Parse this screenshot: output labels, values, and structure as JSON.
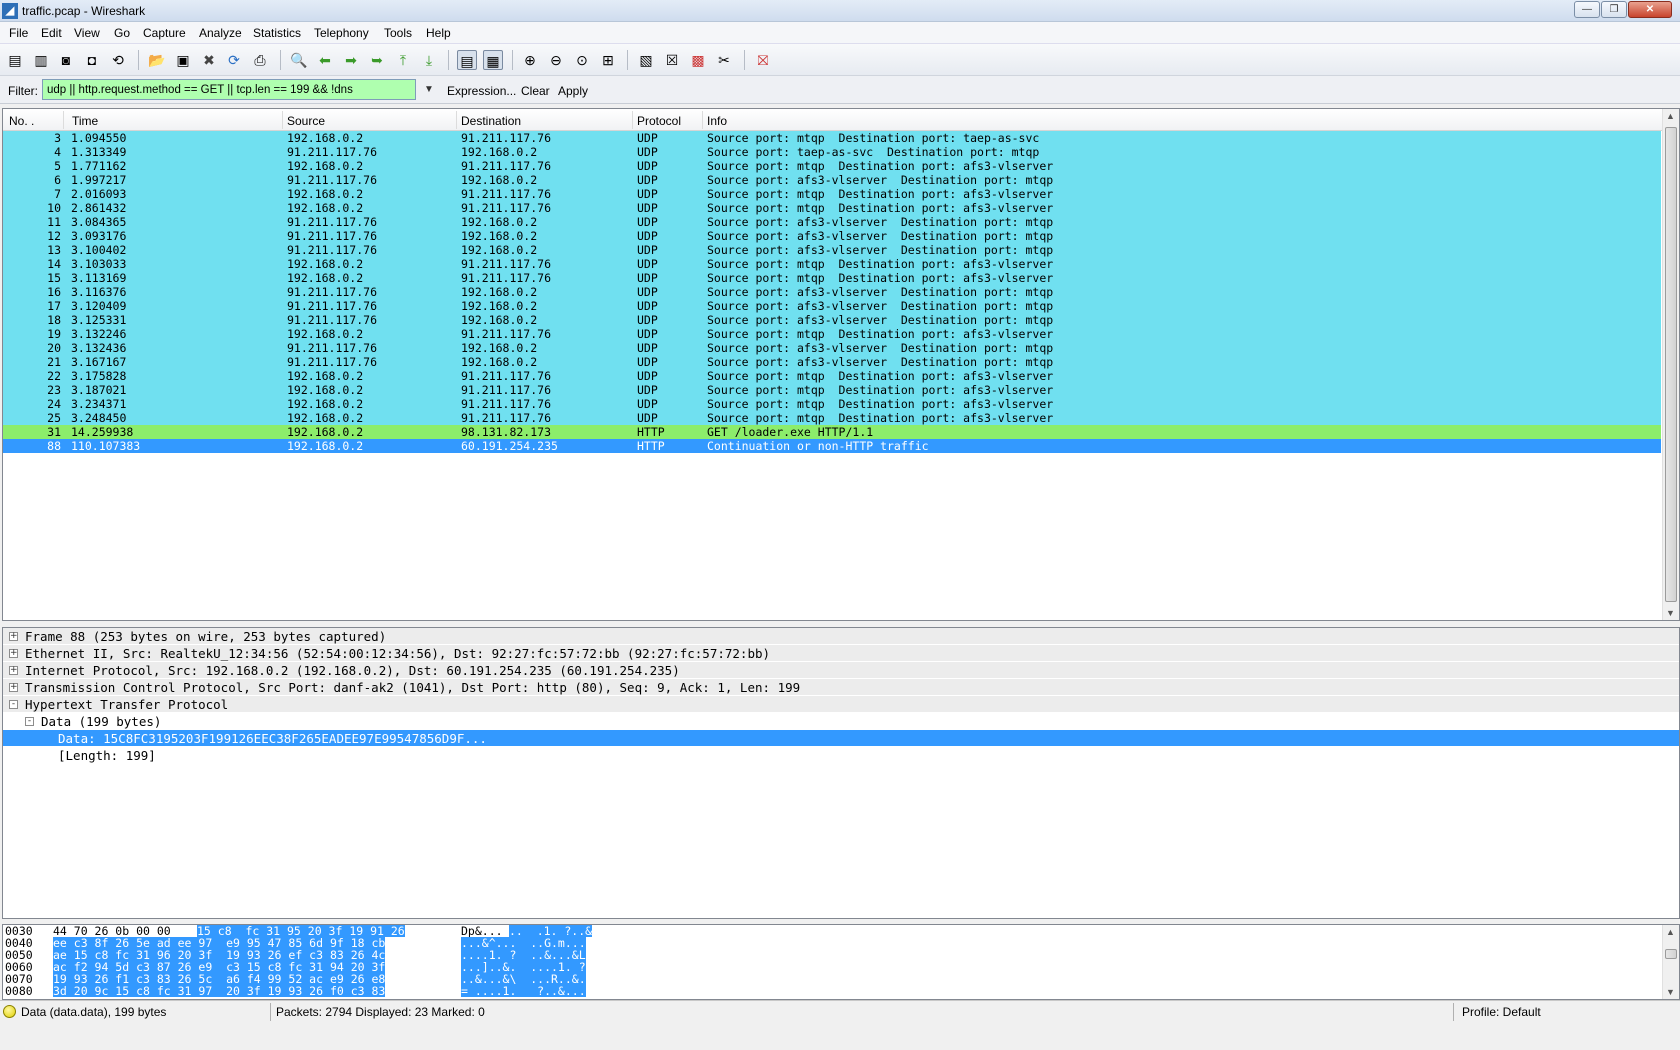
{
  "window": {
    "title": "traffic.pcap - Wireshark",
    "icon": "wireshark-fin-icon"
  },
  "menu": [
    "File",
    "Edit",
    "View",
    "Go",
    "Capture",
    "Analyze",
    "Statistics",
    "Telephony",
    "Tools",
    "Help"
  ],
  "toolbar_icons": [
    "interface-list-icon",
    "capture-options-icon",
    "start-capture-icon",
    "stop-capture-icon",
    "restart-capture-icon",
    "open-file-icon",
    "save-file-icon",
    "close-file-icon",
    "reload-icon",
    "print-icon",
    "find-packet-icon",
    "go-back-icon",
    "go-forward-icon",
    "go-to-packet-icon",
    "first-packet-icon",
    "last-packet-icon",
    "colorize-icon",
    "auto-scroll-icon",
    "zoom-in-icon",
    "zoom-out-icon",
    "normal-size-icon",
    "resize-columns-icon",
    "capture-filters-icon",
    "display-filters-icon",
    "coloring-rules-icon",
    "preferences-icon",
    "help-icon"
  ],
  "filter": {
    "label": "Filter:",
    "value": "udp || http.request.method == GET || tcp.len == 199 && !dns",
    "expression": "Expression...",
    "clear": "Clear",
    "apply": "Apply",
    "valid_color": "#afffaf"
  },
  "packet_list": {
    "columns": [
      "No. .",
      "Time",
      "Source",
      "Destination",
      "Protocol",
      "Info"
    ],
    "rows": [
      {
        "no": "3",
        "time": "1.094550",
        "src": "192.168.0.2",
        "dst": "91.211.117.76",
        "proto": "UDP",
        "info": "Source port: mtqp  Destination port: taep-as-svc",
        "type": "udp"
      },
      {
        "no": "4",
        "time": "1.313349",
        "src": "91.211.117.76",
        "dst": "192.168.0.2",
        "proto": "UDP",
        "info": "Source port: taep-as-svc  Destination port: mtqp",
        "type": "udp"
      },
      {
        "no": "5",
        "time": "1.771162",
        "src": "192.168.0.2",
        "dst": "91.211.117.76",
        "proto": "UDP",
        "info": "Source port: mtqp  Destination port: afs3-vlserver",
        "type": "udp"
      },
      {
        "no": "6",
        "time": "1.997217",
        "src": "91.211.117.76",
        "dst": "192.168.0.2",
        "proto": "UDP",
        "info": "Source port: afs3-vlserver  Destination port: mtqp",
        "type": "udp"
      },
      {
        "no": "7",
        "time": "2.016093",
        "src": "192.168.0.2",
        "dst": "91.211.117.76",
        "proto": "UDP",
        "info": "Source port: mtqp  Destination port: afs3-vlserver",
        "type": "udp"
      },
      {
        "no": "10",
        "time": "2.861432",
        "src": "192.168.0.2",
        "dst": "91.211.117.76",
        "proto": "UDP",
        "info": "Source port: mtqp  Destination port: afs3-vlserver",
        "type": "udp"
      },
      {
        "no": "11",
        "time": "3.084365",
        "src": "91.211.117.76",
        "dst": "192.168.0.2",
        "proto": "UDP",
        "info": "Source port: afs3-vlserver  Destination port: mtqp",
        "type": "udp"
      },
      {
        "no": "12",
        "time": "3.093176",
        "src": "91.211.117.76",
        "dst": "192.168.0.2",
        "proto": "UDP",
        "info": "Source port: afs3-vlserver  Destination port: mtqp",
        "type": "udp"
      },
      {
        "no": "13",
        "time": "3.100402",
        "src": "91.211.117.76",
        "dst": "192.168.0.2",
        "proto": "UDP",
        "info": "Source port: afs3-vlserver  Destination port: mtqp",
        "type": "udp"
      },
      {
        "no": "14",
        "time": "3.103033",
        "src": "192.168.0.2",
        "dst": "91.211.117.76",
        "proto": "UDP",
        "info": "Source port: mtqp  Destination port: afs3-vlserver",
        "type": "udp"
      },
      {
        "no": "15",
        "time": "3.113169",
        "src": "192.168.0.2",
        "dst": "91.211.117.76",
        "proto": "UDP",
        "info": "Source port: mtqp  Destination port: afs3-vlserver",
        "type": "udp"
      },
      {
        "no": "16",
        "time": "3.116376",
        "src": "91.211.117.76",
        "dst": "192.168.0.2",
        "proto": "UDP",
        "info": "Source port: afs3-vlserver  Destination port: mtqp",
        "type": "udp"
      },
      {
        "no": "17",
        "time": "3.120409",
        "src": "91.211.117.76",
        "dst": "192.168.0.2",
        "proto": "UDP",
        "info": "Source port: afs3-vlserver  Destination port: mtqp",
        "type": "udp"
      },
      {
        "no": "18",
        "time": "3.125331",
        "src": "91.211.117.76",
        "dst": "192.168.0.2",
        "proto": "UDP",
        "info": "Source port: afs3-vlserver  Destination port: mtqp",
        "type": "udp"
      },
      {
        "no": "19",
        "time": "3.132246",
        "src": "192.168.0.2",
        "dst": "91.211.117.76",
        "proto": "UDP",
        "info": "Source port: mtqp  Destination port: afs3-vlserver",
        "type": "udp"
      },
      {
        "no": "20",
        "time": "3.132436",
        "src": "91.211.117.76",
        "dst": "192.168.0.2",
        "proto": "UDP",
        "info": "Source port: afs3-vlserver  Destination port: mtqp",
        "type": "udp"
      },
      {
        "no": "21",
        "time": "3.167167",
        "src": "91.211.117.76",
        "dst": "192.168.0.2",
        "proto": "UDP",
        "info": "Source port: afs3-vlserver  Destination port: mtqp",
        "type": "udp"
      },
      {
        "no": "22",
        "time": "3.175828",
        "src": "192.168.0.2",
        "dst": "91.211.117.76",
        "proto": "UDP",
        "info": "Source port: mtqp  Destination port: afs3-vlserver",
        "type": "udp"
      },
      {
        "no": "23",
        "time": "3.187021",
        "src": "192.168.0.2",
        "dst": "91.211.117.76",
        "proto": "UDP",
        "info": "Source port: mtqp  Destination port: afs3-vlserver",
        "type": "udp"
      },
      {
        "no": "24",
        "time": "3.234371",
        "src": "192.168.0.2",
        "dst": "91.211.117.76",
        "proto": "UDP",
        "info": "Source port: mtqp  Destination port: afs3-vlserver",
        "type": "udp"
      },
      {
        "no": "25",
        "time": "3.248450",
        "src": "192.168.0.2",
        "dst": "91.211.117.76",
        "proto": "UDP",
        "info": "Source port: mtqp  Destination port: afs3-vlserver",
        "type": "udp"
      },
      {
        "no": "31",
        "time": "14.259938",
        "src": "192.168.0.2",
        "dst": "98.131.82.173",
        "proto": "HTTP",
        "info": "GET /loader.exe HTTP/1.1",
        "type": "http"
      },
      {
        "no": "88",
        "time": "110.107383",
        "src": "192.168.0.2",
        "dst": "60.191.254.235",
        "proto": "HTTP",
        "info": "Continuation or non-HTTP traffic",
        "type": "selected"
      }
    ],
    "colors": {
      "udp": "#70e0f0",
      "http": "#8ced6b",
      "selected": "#3399ff"
    }
  },
  "details": [
    {
      "text": "Frame 88 (253 bytes on wire, 253 bytes captured)",
      "expander": "+",
      "indent": 0,
      "style": "header"
    },
    {
      "text": "Ethernet II, Src: RealtekU_12:34:56 (52:54:00:12:34:56), Dst: 92:27:fc:57:72:bb (92:27:fc:57:72:bb)",
      "expander": "+",
      "indent": 0,
      "style": "header"
    },
    {
      "text": "Internet Protocol, Src: 192.168.0.2 (192.168.0.2), Dst: 60.191.254.235 (60.191.254.235)",
      "expander": "+",
      "indent": 0,
      "style": "header"
    },
    {
      "text": "Transmission Control Protocol, Src Port: danf-ak2 (1041), Dst Port: http (80), Seq: 9, Ack: 1, Len: 199",
      "expander": "+",
      "indent": 0,
      "style": "header"
    },
    {
      "text": "Hypertext Transfer Protocol",
      "expander": "-",
      "indent": 0,
      "style": "header"
    },
    {
      "text": "Data (199 bytes)",
      "expander": "-",
      "indent": 1,
      "style": "header"
    },
    {
      "text": "Data: 15C8FC3195203F199126EEC38F265EADEE97E99547856D9F...",
      "expander": "",
      "indent": 2,
      "style": "selected"
    },
    {
      "text": "[Length: 199]",
      "expander": "",
      "indent": 2,
      "style": "plain"
    }
  ],
  "bytes": [
    {
      "offset": "0030",
      "hex_plain": "44 70 26 0b 00 00",
      "hex_hl": "15 c8  fc 31 95 20 3f 19 91 26",
      "ascii_plain": "Dp&...",
      "ascii_hl": "..  .1. ?..&"
    },
    {
      "offset": "0040",
      "hex_plain": "",
      "hex_hl": "ee c3 8f 26 5e ad ee 97  e9 95 47 85 6d 9f 18 cb",
      "ascii_plain": "",
      "ascii_hl": "...&^...  ..G.m..."
    },
    {
      "offset": "0050",
      "hex_plain": "",
      "hex_hl": "ae 15 c8 fc 31 96 20 3f  19 93 26 ef c3 83 26 4c",
      "ascii_plain": "",
      "ascii_hl": "....1. ?  ..&...&L"
    },
    {
      "offset": "0060",
      "hex_plain": "",
      "hex_hl": "ac f2 94 5d c3 87 26 e9  c3 15 c8 fc 31 94 20 3f",
      "ascii_plain": "",
      "ascii_hl": "...]..&.  ....1. ?"
    },
    {
      "offset": "0070",
      "hex_plain": "",
      "hex_hl": "19 93 26 f1 c3 83 26 5c  a6 f4 99 52 ac e9 26 e8",
      "ascii_plain": "",
      "ascii_hl": "..&...&\\  ...R..&."
    },
    {
      "offset": "0080",
      "hex_plain": "",
      "hex_hl": "3d 20 9c 15 c8 fc 31 97  20 3f 19 93 26 f0 c3 83",
      "ascii_plain": "",
      "ascii_hl": "= ....1.   ?..&..."
    }
  ],
  "status": {
    "field": "Data (data.data), 199 bytes",
    "packets": "Packets: 2794 Displayed: 23 Marked: 0",
    "profile": "Profile: Default"
  }
}
